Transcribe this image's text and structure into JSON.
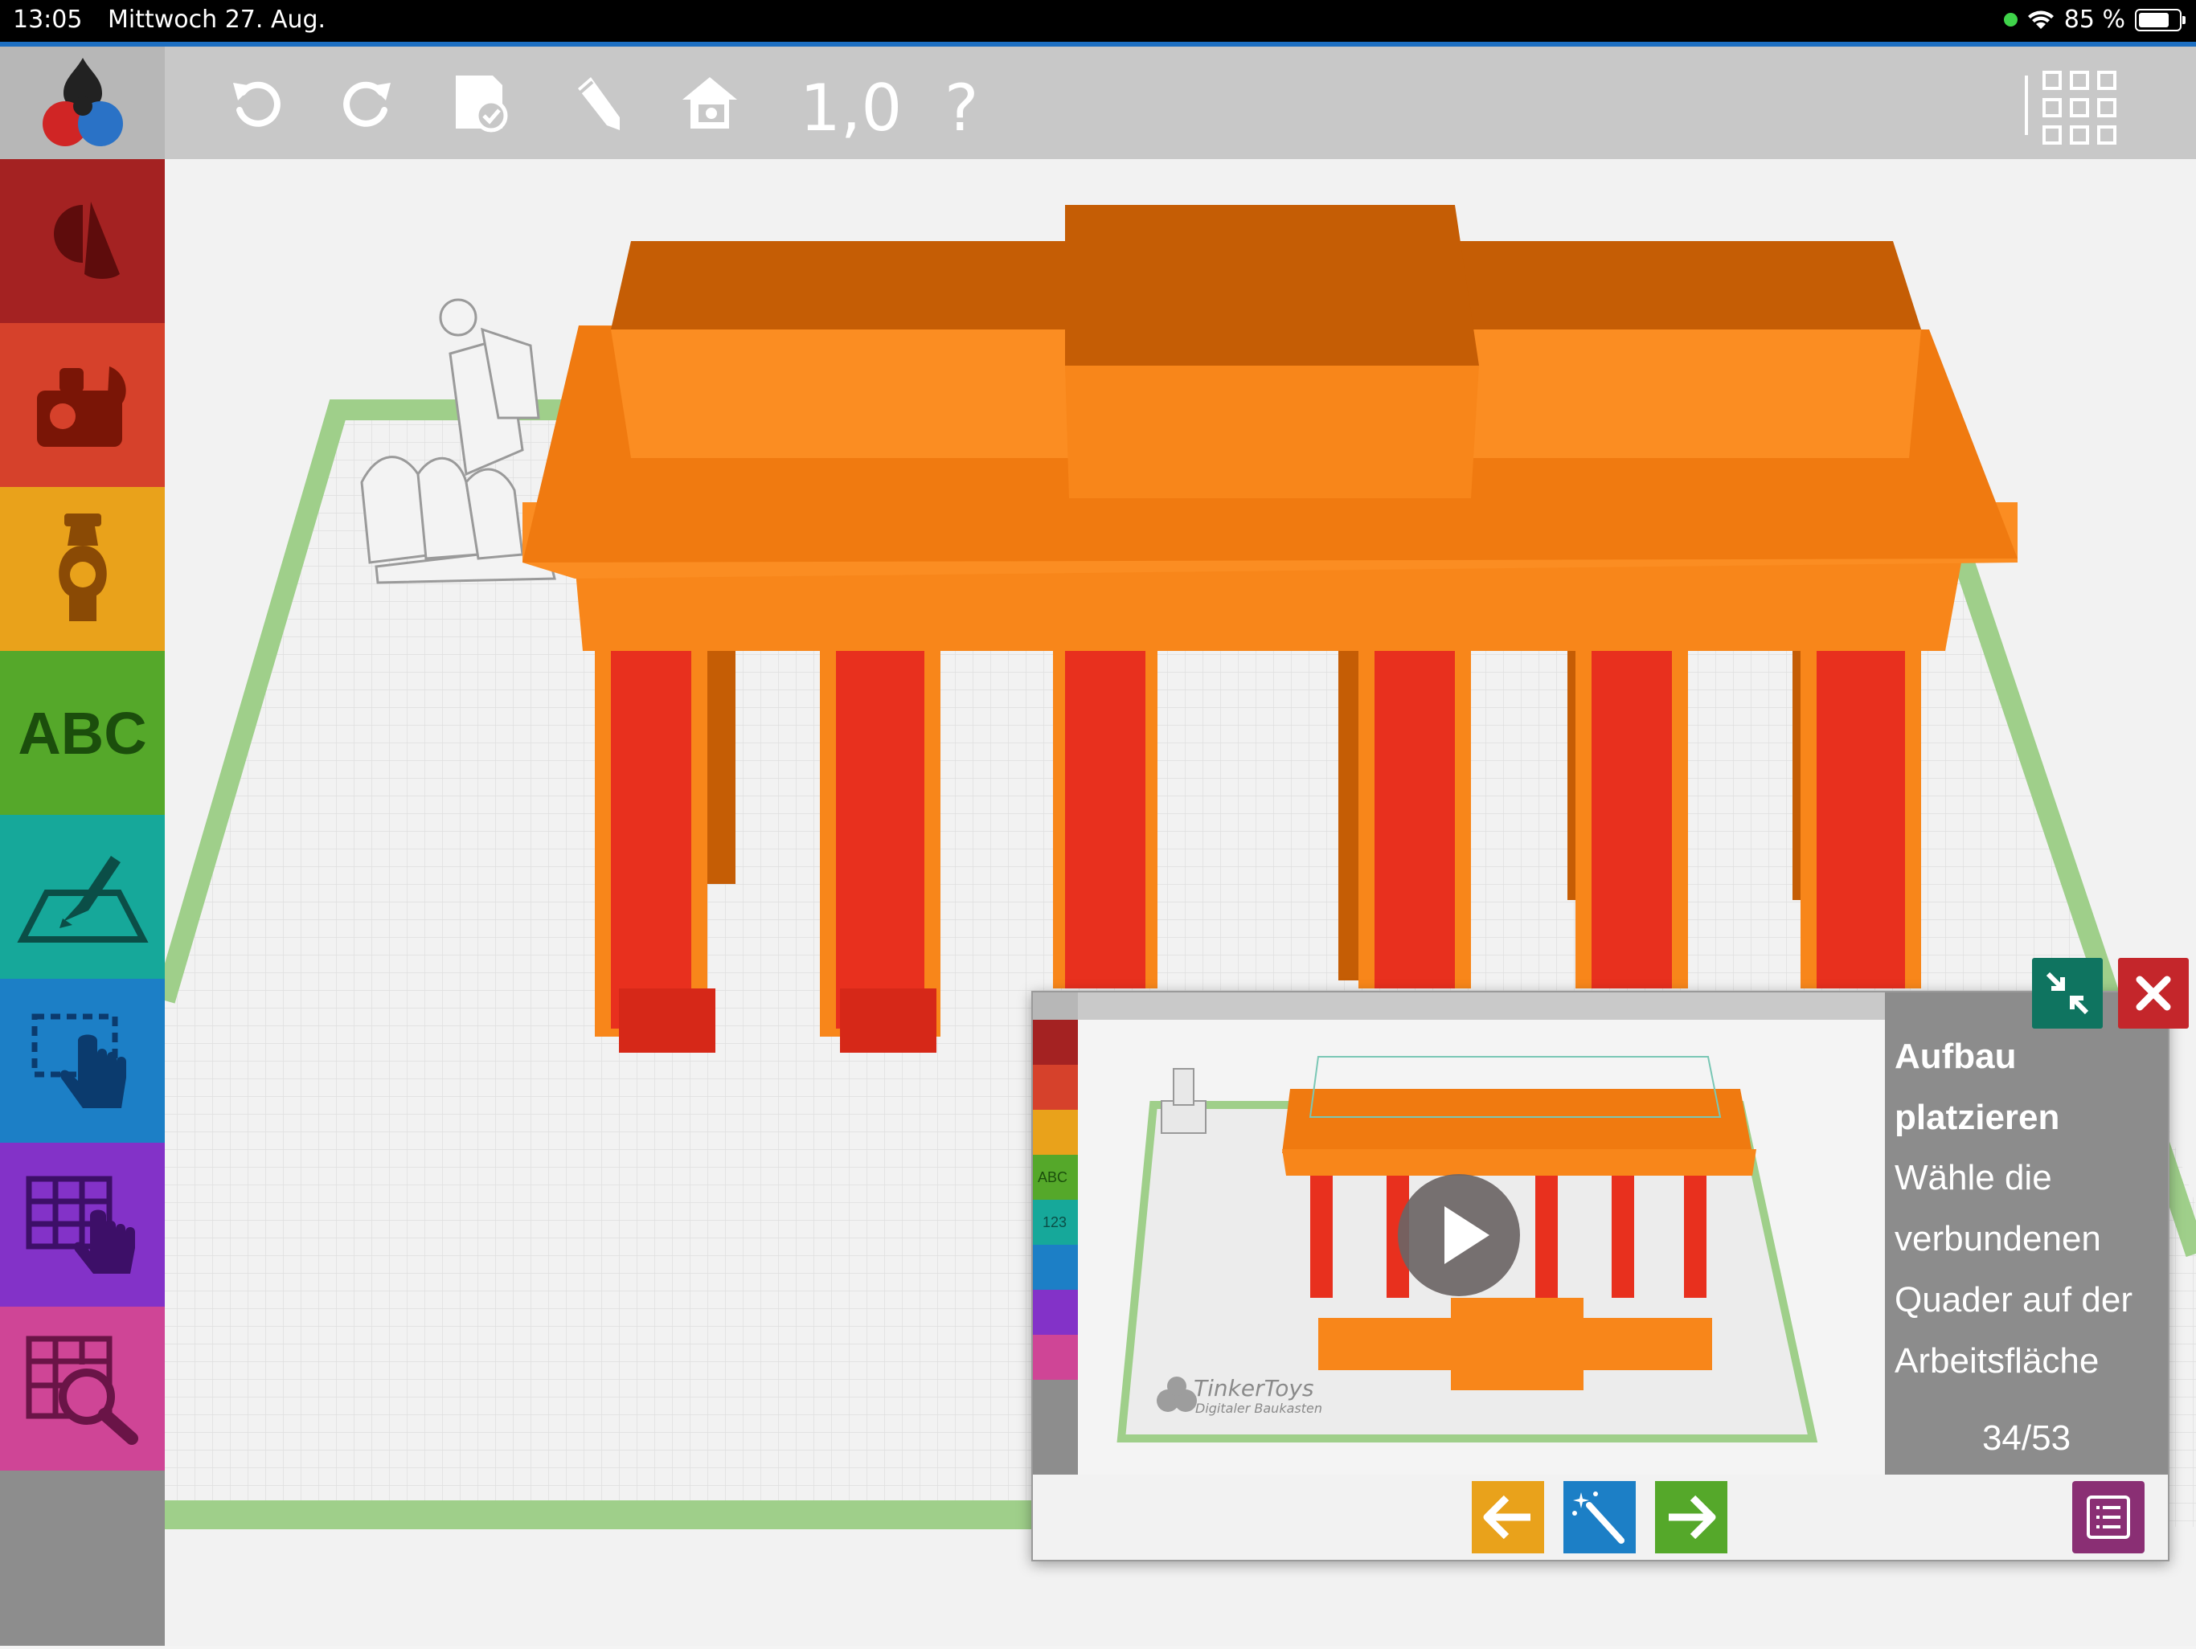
{
  "status_bar": {
    "time": "13:05",
    "date": "Mittwoch 27. Aug.",
    "battery_text": "85 %",
    "battery_level": 0.85
  },
  "toolbar": {
    "zoom_value": "1,0",
    "help_label": "?",
    "icons": [
      "undo-icon",
      "redo-icon",
      "save-icon",
      "pencil-icon",
      "home-camera-icon",
      "help-icon",
      "grid-menu-icon"
    ]
  },
  "sidebar": {
    "items": [
      {
        "name": "shapes",
        "color": "#a42222"
      },
      {
        "name": "parts",
        "color": "#d6412b"
      },
      {
        "name": "figures",
        "color": "#e9a21b"
      },
      {
        "name": "text",
        "color": "#55a82a",
        "label": "ABC"
      },
      {
        "name": "sketch",
        "color": "#16a89a"
      },
      {
        "name": "select",
        "color": "#1c7fc6"
      },
      {
        "name": "grid-select",
        "color": "#8332c8"
      },
      {
        "name": "zoom",
        "color": "#cf4596"
      }
    ]
  },
  "colors": {
    "orange": "#f8861a",
    "orange_dark": "#c55d05",
    "red": "#e8301e",
    "grid_border": "#9fcf8a"
  },
  "tutorial": {
    "title": "Aufbau platzieren",
    "body": "Wähle die verbundenen Quader auf der Arbeitsfläche",
    "counter": "34/53",
    "mini_labels": [
      "ABC",
      "123"
    ],
    "watermark_title": "TinkerToys",
    "watermark_subtitle": "Digitaler Baukasten"
  }
}
